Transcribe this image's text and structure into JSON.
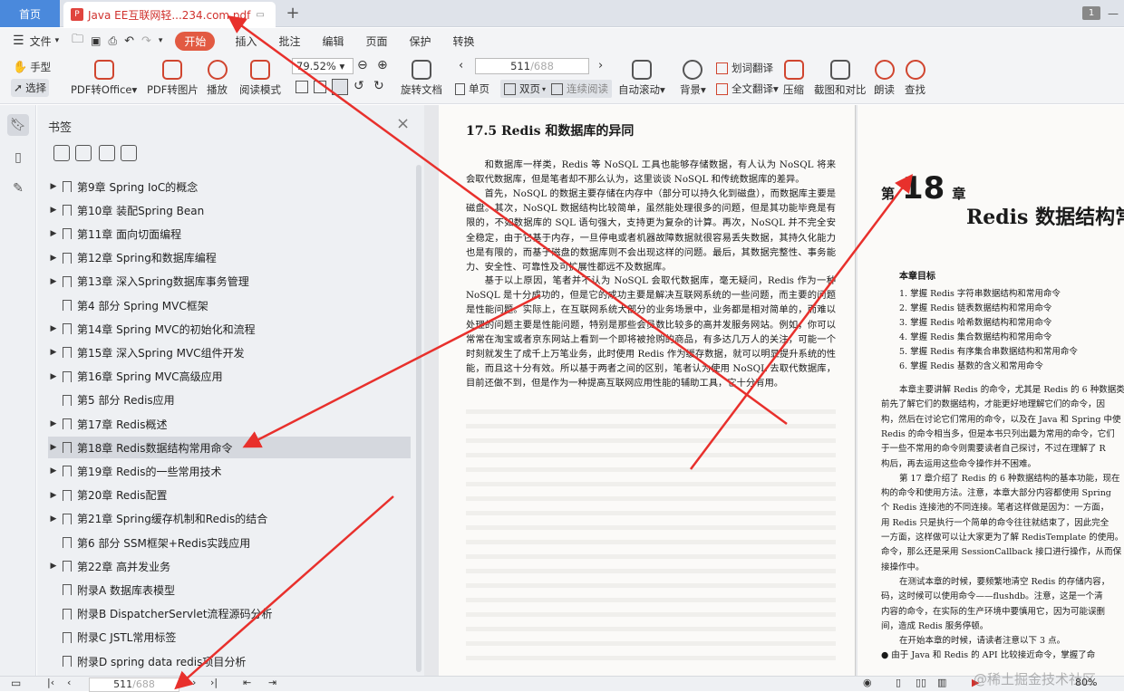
{
  "tabs": {
    "home": "首页",
    "doc_title": "Java EE互联网轻...234.com.pdf",
    "badge": "1"
  },
  "menu": {
    "file": "文件",
    "start": "开始",
    "items": [
      "插入",
      "批注",
      "编辑",
      "页面",
      "保护",
      "转换"
    ]
  },
  "toolbar": {
    "hand": "手型",
    "select": "选择",
    "pdf_office": "PDF转Office",
    "pdf_image": "PDF转图片",
    "play": "播放",
    "read_mode": "阅读模式",
    "zoom": "79.52%",
    "page": "511",
    "page_total": "/688",
    "rotate": "旋转文档",
    "single": "单页",
    "double": "双页",
    "continuous": "连续阅读",
    "autoscroll": "自动滚动",
    "background": "背景",
    "word_translate": "划词翻译",
    "full_translate": "全文翻译",
    "compress": "压缩",
    "screenshot": "截图和对比",
    "read_aloud": "朗读",
    "find": "查找"
  },
  "sidebar": {
    "title": "书签",
    "items": [
      {
        "label": "第9章 Spring IoC的概念",
        "expandable": true
      },
      {
        "label": "第10章 装配Spring Bean",
        "expandable": true
      },
      {
        "label": "第11章 面向切面编程",
        "expandable": true
      },
      {
        "label": "第12章 Spring和数据库编程",
        "expandable": true
      },
      {
        "label": "第13章 深入Spring数据库事务管理",
        "expandable": true
      },
      {
        "label": "第4 部分 Spring MVC框架",
        "expandable": false
      },
      {
        "label": "第14章 Spring MVC的初始化和流程",
        "expandable": true
      },
      {
        "label": "第15章 深入Spring MVC组件开发",
        "expandable": true
      },
      {
        "label": "第16章 Spring MVC高级应用",
        "expandable": true
      },
      {
        "label": "第5 部分 Redis应用",
        "expandable": false
      },
      {
        "label": "第17章 Redis概述",
        "expandable": true
      },
      {
        "label": "第18章 Redis数据结构常用命令",
        "expandable": true,
        "selected": true
      },
      {
        "label": "第19章 Redis的一些常用技术",
        "expandable": true
      },
      {
        "label": "第20章 Redis配置",
        "expandable": true
      },
      {
        "label": "第21章 Spring缓存机制和Redis的结合",
        "expandable": true
      },
      {
        "label": "第6 部分 SSM框架+Redis实践应用",
        "expandable": false
      },
      {
        "label": "第22章 高并发业务",
        "expandable": true
      },
      {
        "label": "附录A 数据库表模型",
        "expandable": false
      },
      {
        "label": "附录B DispatcherServlet流程源码分析",
        "expandable": false
      },
      {
        "label": "附录C JSTL常用标签",
        "expandable": false
      },
      {
        "label": "附录D spring data redis项目分析",
        "expandable": false
      }
    ]
  },
  "page_left": {
    "heading": "17.5   Redis 和数据库的异同",
    "paragraphs": [
      "和数据库一样类，Redis 等 NoSQL 工具也能够存储数据，有人认为 NoSQL 将来会取代数据库，但是笔者却不那么认为，这里谈谈 NoSQL 和传统数据库的差异。",
      "首先，NoSQL 的数据主要存储在内存中（部分可以持久化到磁盘），而数据库主要是磁盘。其次，NoSQL 数据结构比较简单，虽然能处理很多的问题，但是其功能毕竟是有限的，不如数据库的 SQL 语句强大，支持更为复杂的计算。再次，NoSQL 并不完全安全稳定，由于它基于内存，一旦停电或者机器故障数据就很容易丢失数据，其持久化能力也是有限的，而基于磁盘的数据库则不会出现这样的问题。最后，其数据完整性、事务能力、安全性、可靠性及可扩展性都远不及数据库。",
      "基于以上原因，笔者并不认为 NoSQL 会取代数据库，毫无疑问，Redis 作为一种 NoSQL 是十分成功的，但是它的成功主要是解决互联网系统的一些问题，而主要的问题是性能问题。实际上，在互联网系统大部分的业务场景中，业务都是相对简单的，而难以处理的问题主要是性能问题，特别是那些会员数比较多的高并发服务网站。例如，你可以常常在淘宝或者京东网站上看到一个即将被抢购的商品，有多达几万人的关注，可能一个时刻就发生了成千上万笔业务，此时使用 Redis 作为缓存数据，就可以明显提升系统的性能，而且这十分有效。所以基于两者之间的区别，笔者认为使用 NoSQL 去取代数据库，目前还做不到，但是作为一种提高互联网应用性能的辅助工具，它十分有用。"
    ]
  },
  "page_right": {
    "chapter_prefix": "第",
    "chapter_number": "18",
    "chapter_suffix": "章",
    "title": "Redis 数据结构常",
    "goals_title": "本章目标",
    "goals": [
      "1. 掌握 Redis 字符串数据结构和常用命令",
      "2. 掌握 Redis 链表数据结构和常用命令",
      "3. 掌握 Redis 哈希数据结构和常用命令",
      "4. 掌握 Redis 集合数据结构和常用命令",
      "5. 掌握 Redis 有序集合串数据结构和常用命令",
      "6. 掌握 Redis 基数的含义和常用命令"
    ],
    "body": [
      "本章主要讲解 Redis 的命令，尤其是 Redis 的 6 种数据类",
      "前先了解它们的数据结构，才能更好地理解它们的命令，因",
      "构，然后在讨论它们常用的命令，以及在 Java 和 Spring 中使",
      "Redis 的命令相当多，但是本书只列出最为常用的命令，它们",
      "于一些不常用的命令则需要读者自己探讨，不过在理解了 R",
      "构后，再去运用这些命令操作并不困难。",
      "第 17 章介绍了 Redis 的 6 种数据结构的基本功能，现在",
      "构的命令和使用方法。注意，本章大部分内容都使用 Spring",
      "个 Redis 连接池的不同连接。笔者这样做是因为：一方面，",
      "用 Redis 只是执行一个简单的命令往往就结束了，因此完全",
      "一方面，这样做可以让大家更为了解 RedisTemplate 的使用。",
      "命令，那么还是采用 SessionCallback 接口进行操作，从而保",
      "接操作中。",
      "在测试本章的时候，要频繁地清空 Redis 的存储内容，",
      "码，这时候可以使用命令——flushdb。注意，这是一个清",
      "内容的命令，在实际的生产环境中要慎用它，因为可能误删",
      "间，造成 Redis 服务停顿。",
      "在开始本章的时候，请读者注意以下 3 点。",
      "●  由于 Java 和 Redis 的 API 比较接近命令，掌握了命"
    ]
  },
  "status": {
    "page": "511",
    "page_total": "/688",
    "zoom": "80%",
    "watermark": "@稀土掘金技术社区"
  }
}
